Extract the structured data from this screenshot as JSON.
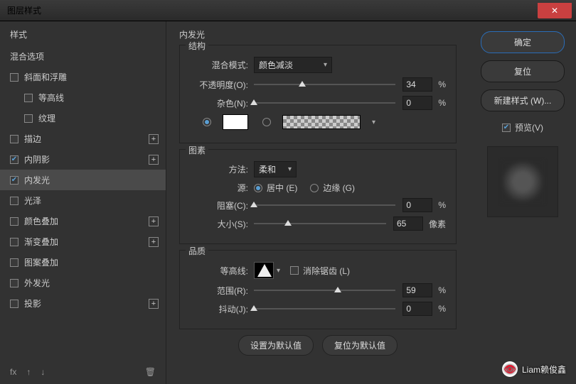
{
  "title": "图层样式",
  "close": "✕",
  "sidebar": {
    "styles_header": "样式",
    "blend_header": "混合选项",
    "items": [
      {
        "label": "斜面和浮雕",
        "checked": false,
        "has_plus": false,
        "sub": false
      },
      {
        "label": "等高线",
        "checked": false,
        "has_plus": false,
        "sub": true
      },
      {
        "label": "纹理",
        "checked": false,
        "has_plus": false,
        "sub": true
      },
      {
        "label": "描边",
        "checked": false,
        "has_plus": true,
        "sub": false
      },
      {
        "label": "内阴影",
        "checked": true,
        "has_plus": true,
        "sub": false
      },
      {
        "label": "内发光",
        "checked": true,
        "has_plus": false,
        "sub": false,
        "selected": true
      },
      {
        "label": "光泽",
        "checked": false,
        "has_plus": false,
        "sub": false
      },
      {
        "label": "颜色叠加",
        "checked": false,
        "has_plus": true,
        "sub": false
      },
      {
        "label": "渐变叠加",
        "checked": false,
        "has_plus": true,
        "sub": false
      },
      {
        "label": "图案叠加",
        "checked": false,
        "has_plus": false,
        "sub": false
      },
      {
        "label": "外发光",
        "checked": false,
        "has_plus": false,
        "sub": false
      },
      {
        "label": "投影",
        "checked": false,
        "has_plus": true,
        "sub": false
      }
    ],
    "footer_fx": "fx"
  },
  "panel": {
    "title": "内发光",
    "structure": {
      "group": "结构",
      "blend_mode_label": "混合模式:",
      "blend_mode_value": "颜色减淡",
      "opacity_label": "不透明度(O):",
      "opacity_value": "34",
      "opacity_unit": "%",
      "noise_label": "杂色(N):",
      "noise_value": "0",
      "noise_unit": "%"
    },
    "elements": {
      "group": "图素",
      "technique_label": "方法:",
      "technique_value": "柔和",
      "source_label": "源:",
      "source_center": "居中 (E)",
      "source_edge": "边缘 (G)",
      "choke_label": "阻塞(C):",
      "choke_value": "0",
      "choke_unit": "%",
      "size_label": "大小(S):",
      "size_value": "65",
      "size_unit": "像素"
    },
    "quality": {
      "group": "品质",
      "contour_label": "等高线:",
      "anti_alias": "消除锯齿 (L)",
      "range_label": "范围(R):",
      "range_value": "59",
      "range_unit": "%",
      "jitter_label": "抖动(J):",
      "jitter_value": "0",
      "jitter_unit": "%"
    },
    "buttons": {
      "make_default": "设置为默认值",
      "reset_default": "复位为默认值"
    }
  },
  "right": {
    "ok": "确定",
    "cancel": "复位",
    "new_style": "新建样式 (W)...",
    "preview": "预览(V)"
  },
  "watermark": "Liam赖俊鑫"
}
